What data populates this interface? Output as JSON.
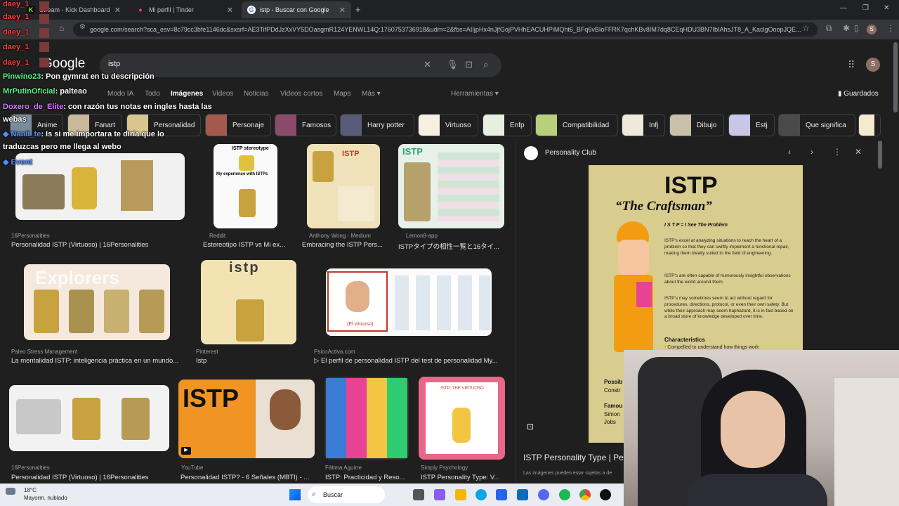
{
  "browser": {
    "tabs": [
      {
        "label": "Stream - Kick Dashboard",
        "fav": "K",
        "fav_color": "#53fc18"
      },
      {
        "label": "Mi perfil | Tinder",
        "fav": "●",
        "fav_color": "#fe3c72"
      },
      {
        "label": "istp - Buscar con Google",
        "fav": "G",
        "fav_color": "#4285f4"
      }
    ],
    "new_tab": "+",
    "url": "google.com/search?sca_esv=8c79cc3bfe1146dc&sxsrf=AE3TifPDdJzXxVY5DOasgmR124YENWL14Q:1760753736918&udm=2&fbs=AIIjpHx4nJjfGojPVHhEACUHPiMQht6_BFq6vBIoFFRK7qchKBv8IM7dq8CEqHDU3BN7IbIAhsJT8_A_KaclgOoopJQE...",
    "profile_initial": "S"
  },
  "google": {
    "logo": "Google",
    "query": "istp",
    "nav_tabs": [
      "Modo IA",
      "Todo",
      "Imágenes",
      "Videos",
      "Noticias",
      "Videos cortos",
      "Maps",
      "Más ▾"
    ],
    "tools": "Herramientas ▾",
    "saved": "Guardados",
    "chips": [
      "Anime",
      "Fanart",
      "Personalidad",
      "Personaje",
      "Famosos",
      "Harry potter",
      "Virtuoso",
      "Enfp",
      "Compatibilidad",
      "Infj",
      "Dibujo",
      "Estj",
      "Que significa"
    ],
    "results": [
      {
        "source": "16Personalities",
        "title": "Personalidad ISTP (Virtuoso) | 16Personalities"
      },
      {
        "source": "Reddit",
        "title": "Estereotipo ISTP vs Mi ex..."
      },
      {
        "source": "Anthony Wong - Medium",
        "title": "Embracing the ISTP Pers..."
      },
      {
        "source": "Lemon8-app",
        "title": "ISTPタイプの相性一覧と16タイ..."
      },
      {
        "source": "Paleo Stress Management",
        "title": "La mentalidad ISTP: inteligencia práctica en un mundo..."
      },
      {
        "source": "Pinterest",
        "title": "Istp"
      },
      {
        "source": "PsicoActiva.com",
        "title": "El perfil de personalidad ISTP del test de personalidad My..."
      },
      {
        "source": "16Personalities",
        "title": "Personalidad ISTP (Virtuoso) | 16Personalities"
      },
      {
        "source": "YouTube",
        "title": "Personalidad ISTP? - 6 Señales (MBTI) - ..."
      },
      {
        "source": "Fátima Aguirre",
        "title": "ISTP: Practicidad y Reso..."
      },
      {
        "source": "Simply Psychology",
        "title": "ISTP Personality Type: V..."
      }
    ],
    "thumb_texts": {
      "stereotype": "ISTP stereotype",
      "experience": "My experience with ISTPs",
      "istp_big": "ISTP",
      "istp_small": "istp",
      "virtuoso_label": "(El virtuoso)",
      "virtuoso_title": "ISTP: THE VIRTUOSO",
      "explorers": "Explorers"
    }
  },
  "panel": {
    "source": "Personality Club",
    "img_title": "ISTP",
    "img_subtitle": "“The Craftsman”",
    "img_tagline": "I S T P = I See The Problem",
    "para1": "ISTP's excel at analyzing situations to reach the heart of a problem so that they can swiftly implement a functional repair, making them ideally suited to the field of engineering.",
    "para2": "ISTP's are often capable of humorously insightful observations about the world around them.",
    "para3": "ISTP's may sometimes seem to act without regard for procedures, directions, protocol, or even their own safety. But while their approach may seem haphazard, it is in fact based on a broad store of knowledge developed over time.",
    "characteristics": "Characteristics",
    "char1": "- Compelled to understand how things work",
    "possib": "Possib",
    "constr": "Constr",
    "famous": "Famou",
    "simon": "Simon",
    "jobs": "Jobs",
    "caption": "ISTP Personality Type | Pers",
    "disclaimer": "Las imágenes pueden estar sujetas a de"
  },
  "chat": [
    {
      "user": "daey_1",
      "text": "",
      "color": "#ff3b3b"
    },
    {
      "user": "daey_1",
      "text": "",
      "color": "#ff3b3b"
    },
    {
      "user": "daey_1",
      "text": "",
      "color": "#ff3b3b"
    },
    {
      "user": "daey_1",
      "text": "",
      "color": "#ff3b3b"
    },
    {
      "user": "daey_1",
      "text": "",
      "color": "#ff3b3b"
    },
    {
      "user": "Pinwino23",
      "text": ": Pon gymrat en tu descripción",
      "color": "#57f287"
    },
    {
      "user": "MrPutinOficial",
      "text": ": palteao",
      "color": "#57f287"
    },
    {
      "user": "Doxero_de_Elite",
      "text": ": con razón tus notas en ingles hasta las",
      "color": "#d27cff"
    },
    {
      "user": "webas",
      "text": "",
      "color": "#ffffff"
    },
    {
      "user": "Nanii_te",
      "text": ": Is si me importara te diría que lo",
      "color": "#4f8cff"
    },
    {
      "user": "",
      "text": "traduzcas pero me llega al webo",
      "color": "#ffffff"
    },
    {
      "user": "Evont",
      "text": "",
      "color": "#4f8cff"
    }
  ],
  "taskbar": {
    "temp": "18°C",
    "weather": "Mayorm. nublado",
    "search": "Buscar"
  }
}
